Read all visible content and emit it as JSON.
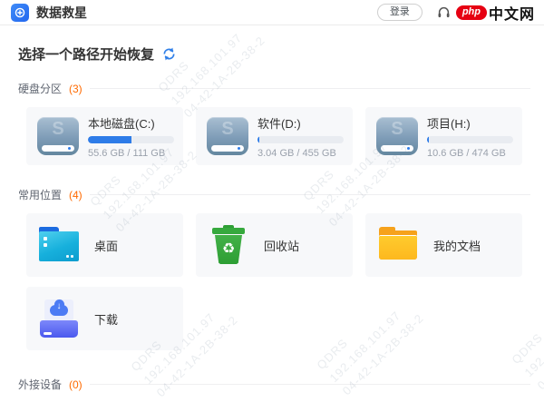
{
  "header": {
    "app_title": "数据救星",
    "login_label": "登录",
    "brand": {
      "php": "php",
      "suffix": "中文网"
    }
  },
  "page": {
    "heading": "选择一个路径开始恢复"
  },
  "sections": {
    "partitions": {
      "label": "硬盘分区",
      "count": "(3)"
    },
    "locations": {
      "label": "常用位置",
      "count": "(4)"
    },
    "external": {
      "label": "外接设备",
      "count": "(0)"
    }
  },
  "disks": [
    {
      "name": "本地磁盘(C:)",
      "usage": "55.6 GB / 111 GB",
      "percent": 50
    },
    {
      "name": "软件(D:)",
      "usage": "3.04 GB / 455 GB",
      "percent": 1.5
    },
    {
      "name": "项目(H:)",
      "usage": "10.6 GB / 474 GB",
      "percent": 2.5
    }
  ],
  "locations": [
    {
      "name": "桌面"
    },
    {
      "name": "回收站"
    },
    {
      "name": "我的文档"
    },
    {
      "name": "下载"
    }
  ],
  "icons": {
    "drive_glyph": "S",
    "recycle_glyph": "♻",
    "download_arrow": "↓"
  },
  "watermark": {
    "lines": [
      "QDRS",
      "192.168.101.97",
      "04-42-1A-2B-38-2"
    ]
  },
  "colors": {
    "accent_blue": "#2E7CE8",
    "count_orange": "#FF6A00",
    "brand_red": "#E60012",
    "recycle_green": "#33A73C",
    "folder_yellow": "#FFC41F",
    "desktop_cyan": "#18B3DE",
    "download_indigo": "#5A66F2",
    "card_bg": "#F7F8FA"
  }
}
